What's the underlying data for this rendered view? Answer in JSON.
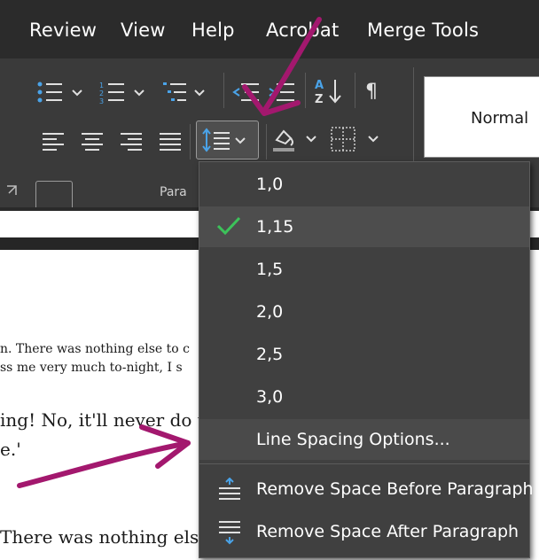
{
  "menubar": {
    "items": [
      "Review",
      "View",
      "Help",
      "Acrobat",
      "Merge Tools"
    ]
  },
  "ribbon": {
    "group_label": "Para",
    "style_normal": "Normal"
  },
  "line_spacing_menu": {
    "options": [
      "1,0",
      "1,15",
      "1,5",
      "2,0",
      "2,5",
      "3,0"
    ],
    "selected": "1,15",
    "line_spacing_options": "Line Spacing Options...",
    "remove_before": "Remove Space Before Paragraph",
    "remove_after": "Remove Space After Paragraph"
  },
  "document": {
    "lines": [
      "n. There was nothing else to c",
      "ss me very much to-night, I s",
      "ing! No, it'll never do t",
      "e.'",
      "There was nothing else"
    ]
  },
  "colors": {
    "menubar_bg": "#2b2b2b",
    "ribbon_bg": "#3a3a3a",
    "menu_bg": "#404040",
    "accent_blue": "#4aa3e8",
    "check_green": "#3cc25a",
    "annotation": "#a3186e"
  }
}
